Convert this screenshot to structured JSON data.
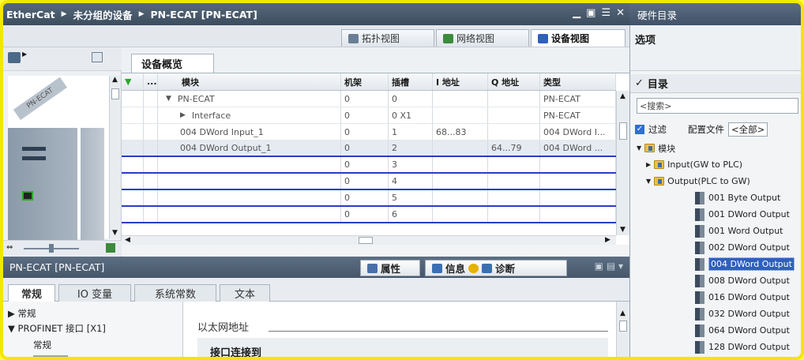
{
  "titlebar": {
    "crumbs": [
      "EtherCat",
      "未分组的设备",
      "PN-ECAT [PN-ECAT]"
    ],
    "window_controls": [
      "minimize-icon",
      "restore-icon",
      "tile-icon",
      "close-icon"
    ]
  },
  "hw_catalog_title": "硬件目录",
  "view_tabs": [
    {
      "label": "拓扑视图",
      "icon": "topology-icon"
    },
    {
      "label": "网络视图",
      "icon": "network-icon"
    },
    {
      "label": "设备视图",
      "icon": "device-icon",
      "active": true
    }
  ],
  "device_label": "PN-ECAT",
  "overview": {
    "tab": "设备概览",
    "columns": [
      "",
      "...",
      "模块",
      "机架",
      "插槽",
      "I 地址",
      "Q 地址",
      "类型"
    ],
    "rows": [
      {
        "module": "PN-ECAT",
        "expander": "▼",
        "rack": "0",
        "slot": "0",
        "i_addr": "",
        "q_addr": "",
        "type": "PN-ECAT"
      },
      {
        "module": "Interface",
        "expander": "▶",
        "rack": "0",
        "slot": "0 X1",
        "i_addr": "",
        "q_addr": "",
        "type": "PN-ECAT"
      },
      {
        "module": "004 DWord Input_1",
        "expander": "",
        "rack": "0",
        "slot": "1",
        "i_addr": "68...83",
        "q_addr": "",
        "type": "004 DWord I..."
      },
      {
        "module": "004 DWord Output_1",
        "expander": "",
        "rack": "0",
        "slot": "2",
        "i_addr": "",
        "q_addr": "64...79",
        "type": "004 DWord ..."
      },
      {
        "module": "",
        "expander": "",
        "rack": "0",
        "slot": "3",
        "i_addr": "",
        "q_addr": "",
        "type": ""
      },
      {
        "module": "",
        "expander": "",
        "rack": "0",
        "slot": "4",
        "i_addr": "",
        "q_addr": "",
        "type": ""
      },
      {
        "module": "",
        "expander": "",
        "rack": "0",
        "slot": "5",
        "i_addr": "",
        "q_addr": "",
        "type": ""
      },
      {
        "module": "",
        "expander": "",
        "rack": "0",
        "slot": "6",
        "i_addr": "",
        "q_addr": "",
        "type": ""
      }
    ]
  },
  "properties": {
    "title": "PN-ECAT [PN-ECAT]",
    "tabs": [
      {
        "label": "属性",
        "icon": "properties-icon"
      },
      {
        "label": "信息",
        "icon": "info-icon"
      },
      {
        "label": "诊断",
        "icon": "diagnostics-icon"
      }
    ],
    "subtabs": [
      "常规",
      "IO 变量",
      "系统常数",
      "文本"
    ],
    "nav": [
      "常规",
      "PROFINET 接口 [X1]",
      "常规"
    ],
    "nav_expanders": [
      "▶",
      "▼",
      ""
    ],
    "section": "以太网地址",
    "subsection": "接口连接到"
  },
  "catalog": {
    "options_label": "选项",
    "catalog_label": "目录",
    "search_placeholder": "<搜索>",
    "filter_label": "过滤",
    "profile_label": "配置文件",
    "profile_value": "<全部>",
    "tree": [
      {
        "label": "模块",
        "level": 0,
        "kind": "folder",
        "expander": "▼"
      },
      {
        "label": "Input(GW to PLC)",
        "level": 1,
        "kind": "folder",
        "expander": "▶"
      },
      {
        "label": "Output(PLC to GW)",
        "level": 1,
        "kind": "folder",
        "expander": "▼"
      },
      {
        "label": "001 Byte Output",
        "level": 2,
        "kind": "leaf"
      },
      {
        "label": "001 DWord Output",
        "level": 2,
        "kind": "leaf"
      },
      {
        "label": "001 Word Output",
        "level": 2,
        "kind": "leaf"
      },
      {
        "label": "002 DWord Output",
        "level": 2,
        "kind": "leaf"
      },
      {
        "label": "004 DWord Output",
        "level": 2,
        "kind": "leaf",
        "selected": true
      },
      {
        "label": "008 DWord Output",
        "level": 2,
        "kind": "leaf"
      },
      {
        "label": "016 DWord Output",
        "level": 2,
        "kind": "leaf"
      },
      {
        "label": "032 DWord Output",
        "level": 2,
        "kind": "leaf"
      },
      {
        "label": "064 DWord Output",
        "level": 2,
        "kind": "leaf"
      },
      {
        "label": "128 DWord Output",
        "level": 2,
        "kind": "leaf"
      }
    ]
  },
  "colors": {
    "selection": "#2f5fbf",
    "slot_line": "#2a3cc8",
    "frame": "#f3e600"
  }
}
